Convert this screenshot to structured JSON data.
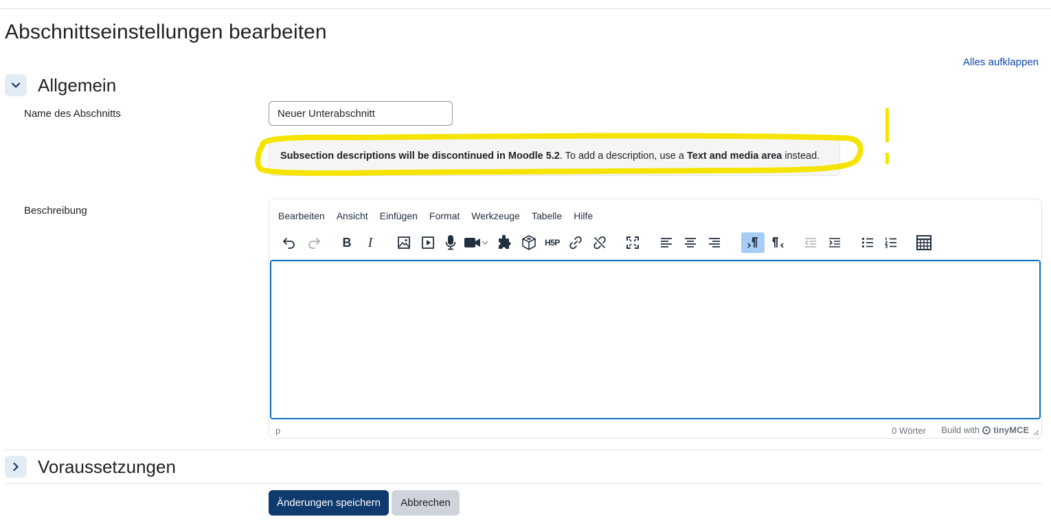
{
  "page": {
    "title": "Abschnittseinstellungen bearbeiten",
    "expand_all": "Alles aufklappen"
  },
  "section_general": {
    "title": "Allgemein",
    "expanded": true,
    "name_label": "Name des Abschnitts",
    "name_value": "Neuer Unterabschnitt",
    "notice": {
      "bold_1": "Subsection descriptions will be discontinued in Moodle 5.2",
      "text_1": ". To add a description, use a ",
      "bold_2": "Text and media area",
      "text_2": " instead."
    },
    "description_label": "Beschreibung"
  },
  "editor": {
    "menu": [
      "Bearbeiten",
      "Ansicht",
      "Einfügen",
      "Format",
      "Werkzeuge",
      "Tabelle",
      "Hilfe"
    ],
    "toolbar_icons": [
      "undo-icon",
      "redo-icon",
      "bold-icon",
      "italic-icon",
      "image-icon",
      "media-icon",
      "microphone-icon",
      "video-camera-icon",
      "puzzle-icon",
      "cube-icon",
      "h5p-icon",
      "link-icon",
      "unlink-icon",
      "fullscreen-icon",
      "align-left-icon",
      "align-center-icon",
      "align-right-icon",
      "ltr-icon",
      "rtl-icon",
      "outdent-icon",
      "indent-icon",
      "bullet-list-icon",
      "numbered-list-icon",
      "calculator-icon"
    ],
    "active_tool": "ltr-icon",
    "content": "",
    "status_path": "p",
    "word_count": "0 Wörter",
    "build_with": "Build with",
    "brand": "tinyMCE"
  },
  "section_restrictions": {
    "title": "Voraussetzungen",
    "expanded": false
  },
  "buttons": {
    "save": "Änderungen speichern",
    "cancel": "Abbrechen"
  },
  "colors": {
    "primary": "#0f3a6e",
    "link": "#0f47ad",
    "editor_focus": "#0f6cbf",
    "highlight": "#f5e400",
    "active_tool_bg": "#a6ccf7"
  }
}
